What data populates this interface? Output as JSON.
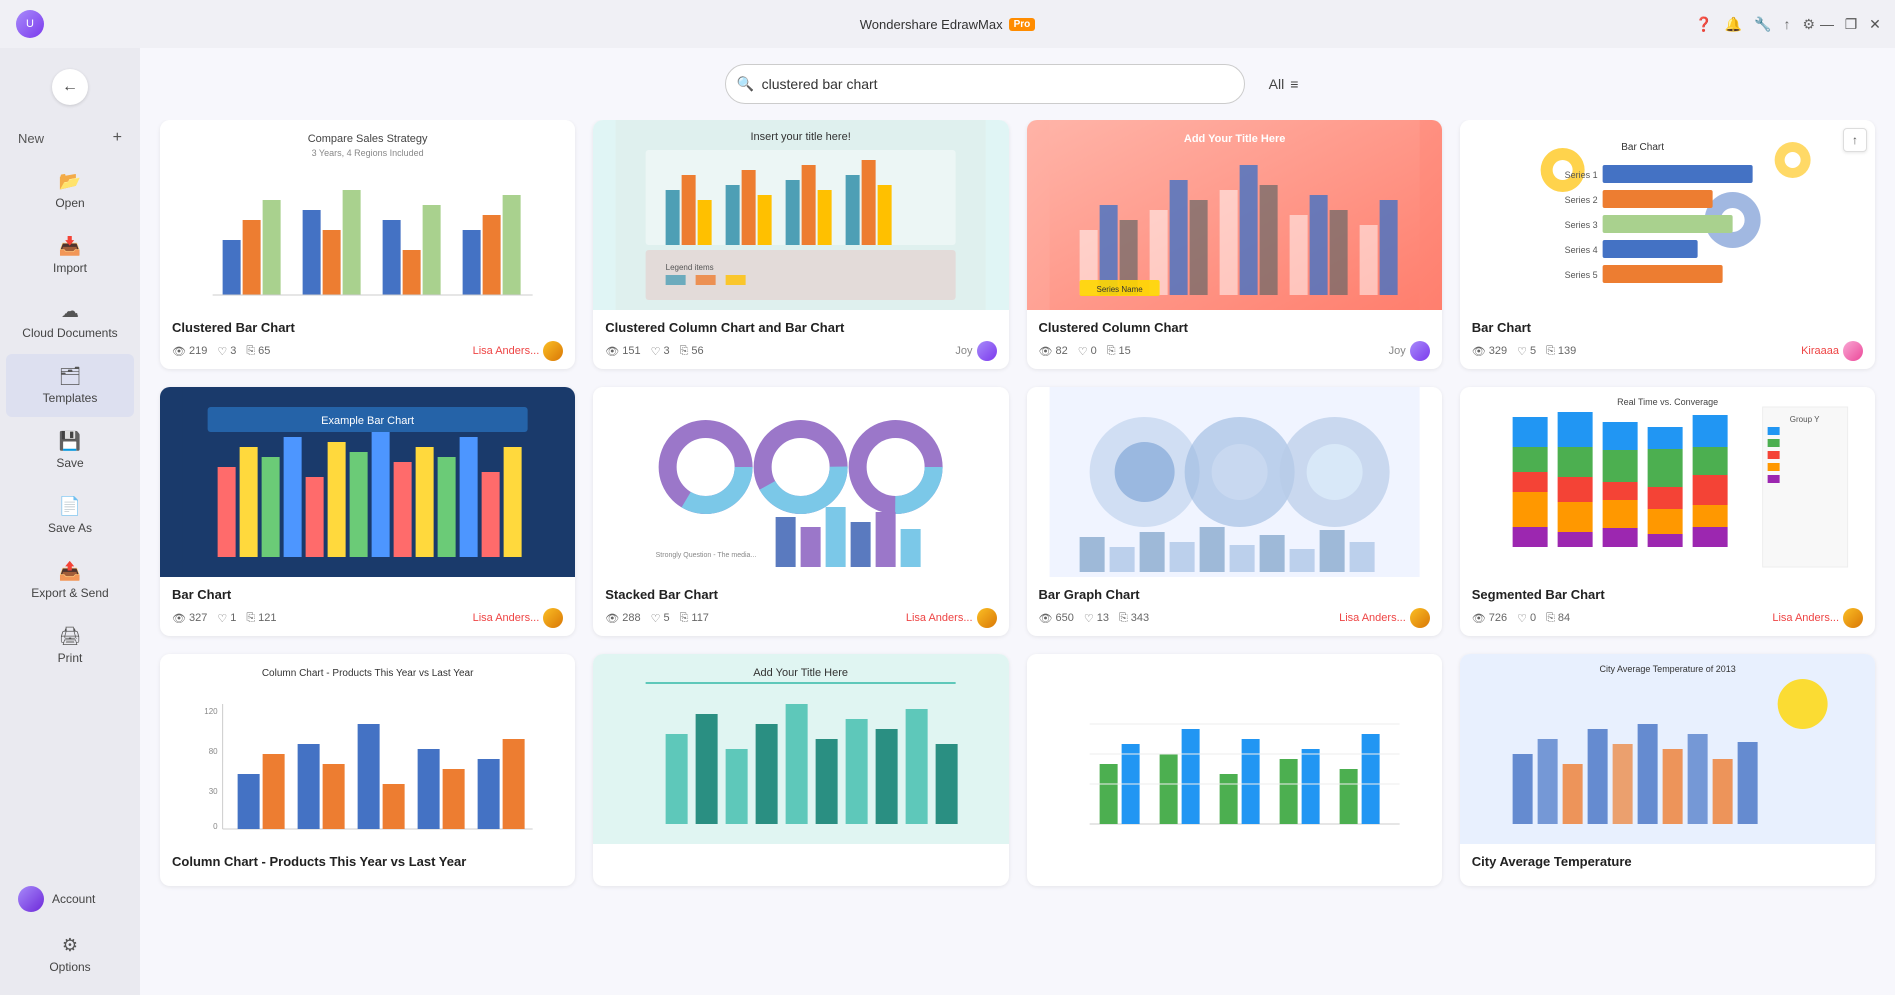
{
  "app": {
    "title": "Wondershare EdrawMax",
    "pro_badge": "Pro"
  },
  "titlebar": {
    "controls": [
      "minimize",
      "maximize",
      "close"
    ],
    "right_icons": [
      "help",
      "notification",
      "tools",
      "share",
      "settings"
    ]
  },
  "sidebar": {
    "back_label": "←",
    "items": [
      {
        "id": "new",
        "label": "New",
        "icon": "+"
      },
      {
        "id": "open",
        "label": "Open",
        "icon": "📂"
      },
      {
        "id": "import",
        "label": "Import",
        "icon": "📥"
      },
      {
        "id": "cloud",
        "label": "Cloud Documents",
        "icon": "☁"
      },
      {
        "id": "templates",
        "label": "Templates",
        "icon": "🗂"
      },
      {
        "id": "save",
        "label": "Save",
        "icon": "💾"
      },
      {
        "id": "saveas",
        "label": "Save As",
        "icon": "📄"
      },
      {
        "id": "export",
        "label": "Export & Send",
        "icon": "📤"
      },
      {
        "id": "print",
        "label": "Print",
        "icon": "🖨"
      }
    ],
    "bottom_items": [
      {
        "id": "account",
        "label": "Account",
        "icon": "👤"
      },
      {
        "id": "options",
        "label": "Options",
        "icon": "⚙"
      }
    ]
  },
  "search": {
    "placeholder": "clustered bar chart",
    "value": "clustered bar chart",
    "filter_label": "All"
  },
  "cards": [
    {
      "id": "card1",
      "title": "Clustered Bar Chart",
      "views": "219",
      "likes": "3",
      "copies": "65",
      "author": "Lisa Anders...",
      "author_color": "orange",
      "thumb_type": "clustered_bar"
    },
    {
      "id": "card2",
      "title": "Clustered Column Chart and Bar Chart",
      "views": "151",
      "likes": "3",
      "copies": "56",
      "author": "Joy",
      "author_color": "purple",
      "thumb_type": "clustered_col_bar"
    },
    {
      "id": "card3",
      "title": "Clustered Column Chart",
      "views": "82",
      "likes": "0",
      "copies": "15",
      "author": "Joy",
      "author_color": "purple",
      "thumb_type": "clustered_col"
    },
    {
      "id": "card4",
      "title": "Bar Chart",
      "views": "329",
      "likes": "5",
      "copies": "139",
      "author": "Kiraaaa",
      "author_color": "pink",
      "thumb_type": "bar_chart_horz"
    },
    {
      "id": "card5",
      "title": "Bar Chart",
      "views": "327",
      "likes": "1",
      "copies": "121",
      "author": "Lisa Anders...",
      "author_color": "orange",
      "thumb_type": "bar_chart_colored"
    },
    {
      "id": "card6",
      "title": "Stacked Bar Chart",
      "views": "288",
      "likes": "5",
      "copies": "117",
      "author": "Lisa Anders...",
      "author_color": "orange",
      "thumb_type": "stacked_bar"
    },
    {
      "id": "card7",
      "title": "Bar Graph Chart",
      "views": "650",
      "likes": "13",
      "copies": "343",
      "author": "Lisa Anders...",
      "author_color": "orange",
      "thumb_type": "bar_graph"
    },
    {
      "id": "card8",
      "title": "Segmented Bar Chart",
      "views": "726",
      "likes": "0",
      "copies": "84",
      "author": "Lisa Anders...",
      "author_color": "orange",
      "thumb_type": "segmented_bar"
    },
    {
      "id": "card9",
      "title": "Column Chart - Products This Year vs Last Year",
      "views": "",
      "likes": "",
      "copies": "",
      "author": "",
      "author_color": "blue",
      "thumb_type": "col_products"
    },
    {
      "id": "card10",
      "title": "",
      "views": "",
      "likes": "",
      "copies": "",
      "author": "",
      "author_color": "blue",
      "thumb_type": "col_teal"
    },
    {
      "id": "card11",
      "title": "",
      "views": "",
      "likes": "",
      "copies": "",
      "author": "",
      "author_color": "blue",
      "thumb_type": "col_green"
    },
    {
      "id": "card12",
      "title": "City Average Temperature",
      "views": "",
      "likes": "",
      "copies": "",
      "author": "",
      "author_color": "blue",
      "thumb_type": "temp_chart"
    }
  ],
  "icons": {
    "eye": "👁",
    "heart": "♡",
    "copy": "⎘",
    "back": "←",
    "search": "🔍",
    "filter": "≡",
    "minimize": "—",
    "maximize": "❐",
    "close": "✕",
    "help": "?",
    "notification": "🔔",
    "tools": "⚙",
    "share": "⬆",
    "settings": "⚙",
    "up_arrow": "↑"
  }
}
